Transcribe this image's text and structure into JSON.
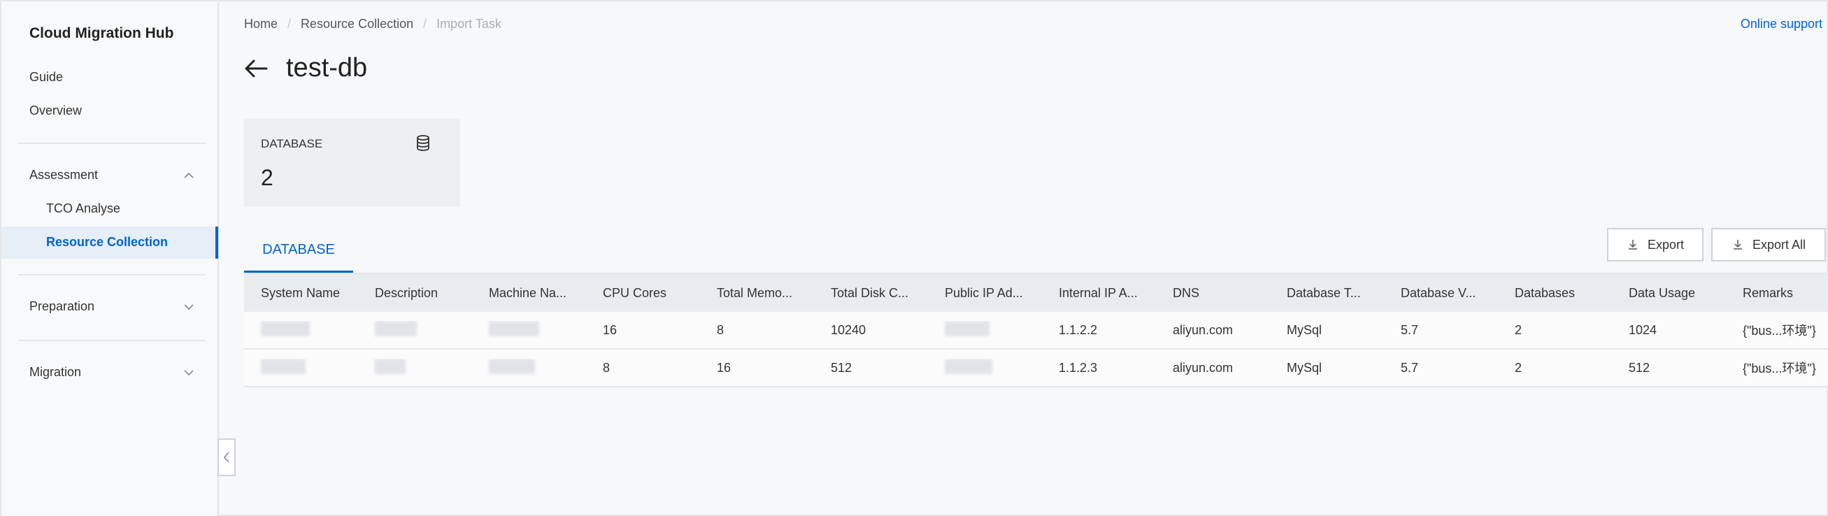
{
  "sidebar": {
    "title": "Cloud Migration Hub",
    "items": [
      {
        "label": "Guide"
      },
      {
        "label": "Overview"
      }
    ],
    "groups": [
      {
        "label": "Assessment",
        "expanded": true,
        "children": [
          {
            "label": "TCO Analyse",
            "active": false
          },
          {
            "label": "Resource Collection",
            "active": true
          }
        ]
      },
      {
        "label": "Preparation",
        "expanded": false
      },
      {
        "label": "Migration",
        "expanded": false
      }
    ]
  },
  "header": {
    "breadcrumb": [
      "Home",
      "Resource Collection",
      "Import Task"
    ],
    "online_support": "Online support",
    "title": "test-db"
  },
  "stat": {
    "label": "DATABASE",
    "value": "2",
    "icon": "database-icon"
  },
  "tab": {
    "label": "DATABASE"
  },
  "actions": {
    "export": "Export",
    "export_all": "Export All"
  },
  "table": {
    "columns": [
      "System Name",
      "Description",
      "Machine Na...",
      "CPU Cores",
      "Total Memo...",
      "Total Disk C...",
      "Public IP Ad...",
      "Internal IP A...",
      "DNS",
      "Database T...",
      "Database V...",
      "Databases",
      "Data Usage",
      "Remarks"
    ],
    "rows": [
      [
        "",
        "",
        "",
        "16",
        "8",
        "10240",
        "",
        "1.1.2.2",
        "aliyun.com",
        "MySql",
        "5.7",
        "2",
        "1024",
        "{\"bus...环境\"}"
      ],
      [
        "",
        "",
        "",
        "8",
        "16",
        "512",
        "",
        "1.1.2.3",
        "aliyun.com",
        "MySql",
        "5.7",
        "2",
        "512",
        "{\"bus...环境\"}"
      ]
    ]
  },
  "colors": {
    "accent": "#0064c8",
    "active_bg": "#e6eef8"
  }
}
